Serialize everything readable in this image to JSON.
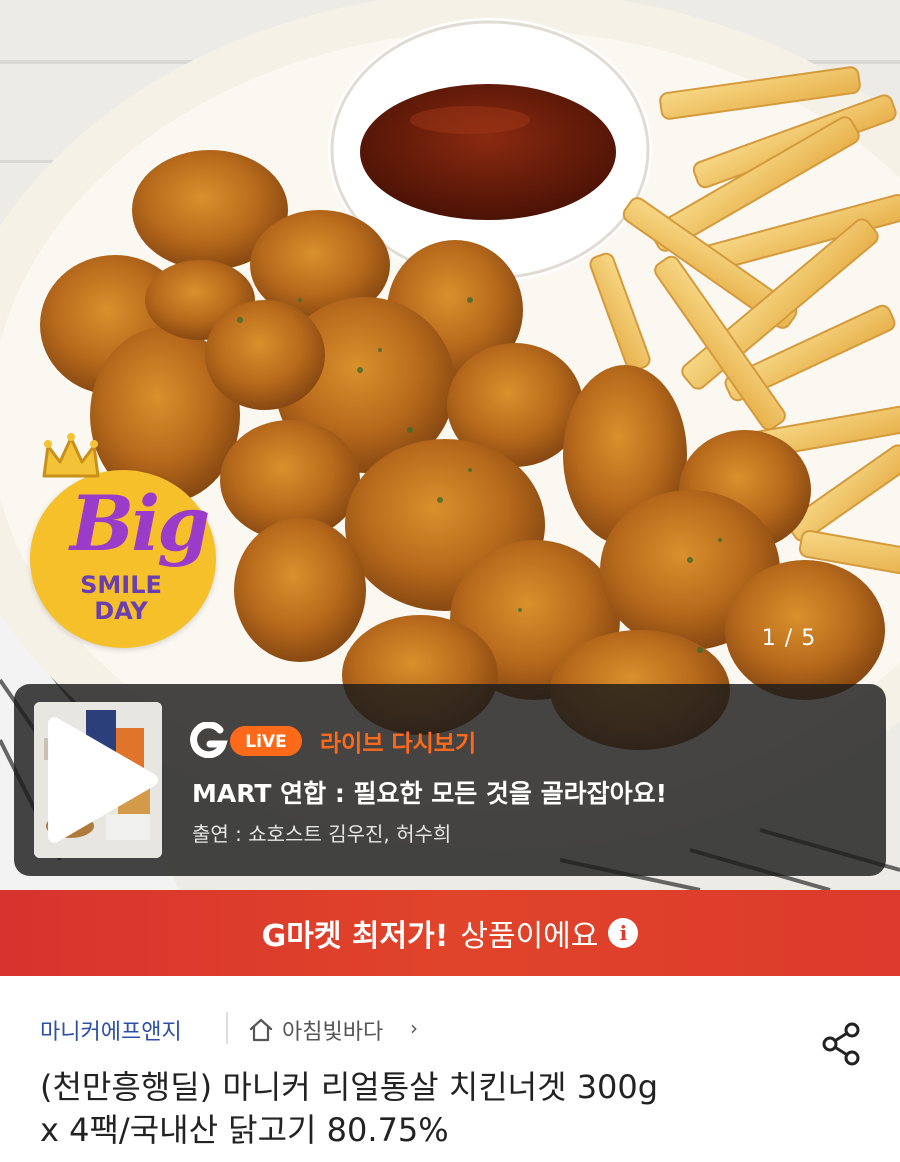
{
  "hero": {
    "badge": {
      "big": "Big",
      "smile": "SMILE",
      "day": "DAY"
    },
    "pager": "1 / 5"
  },
  "live": {
    "logo_g": "G",
    "logo_live": "LiVE",
    "replay_label": "라이브 다시보기",
    "title": "MART 연합 : 필요한 모든 것을 골라잡아요!",
    "cast": "출연 : 쇼호스트 김우진, 허수희"
  },
  "lowest_price": {
    "strong": "G마켓 최저가!",
    "rest": "상품이에요",
    "info_icon": "i"
  },
  "product": {
    "seller": "마니커에프앤지",
    "store": "아침빛바다",
    "store_arrow": "›",
    "title_line1": "(천만흥행딜) 마니커 리얼통살 치킨너겟 300g",
    "title_line2": "x 4팩/국내산 닭고기 80.75%"
  },
  "icons": {
    "home": "home-icon",
    "share": "share-icon",
    "play": "play-icon",
    "crown": "crown-icon",
    "info": "info-icon"
  },
  "colors": {
    "accent_orange": "#ff6a1a",
    "banner_red": "#dc3a2c",
    "seller_blue": "#2d4fa6",
    "badge_yellow": "#f5c02a",
    "badge_purple": "#9a3cc9"
  }
}
